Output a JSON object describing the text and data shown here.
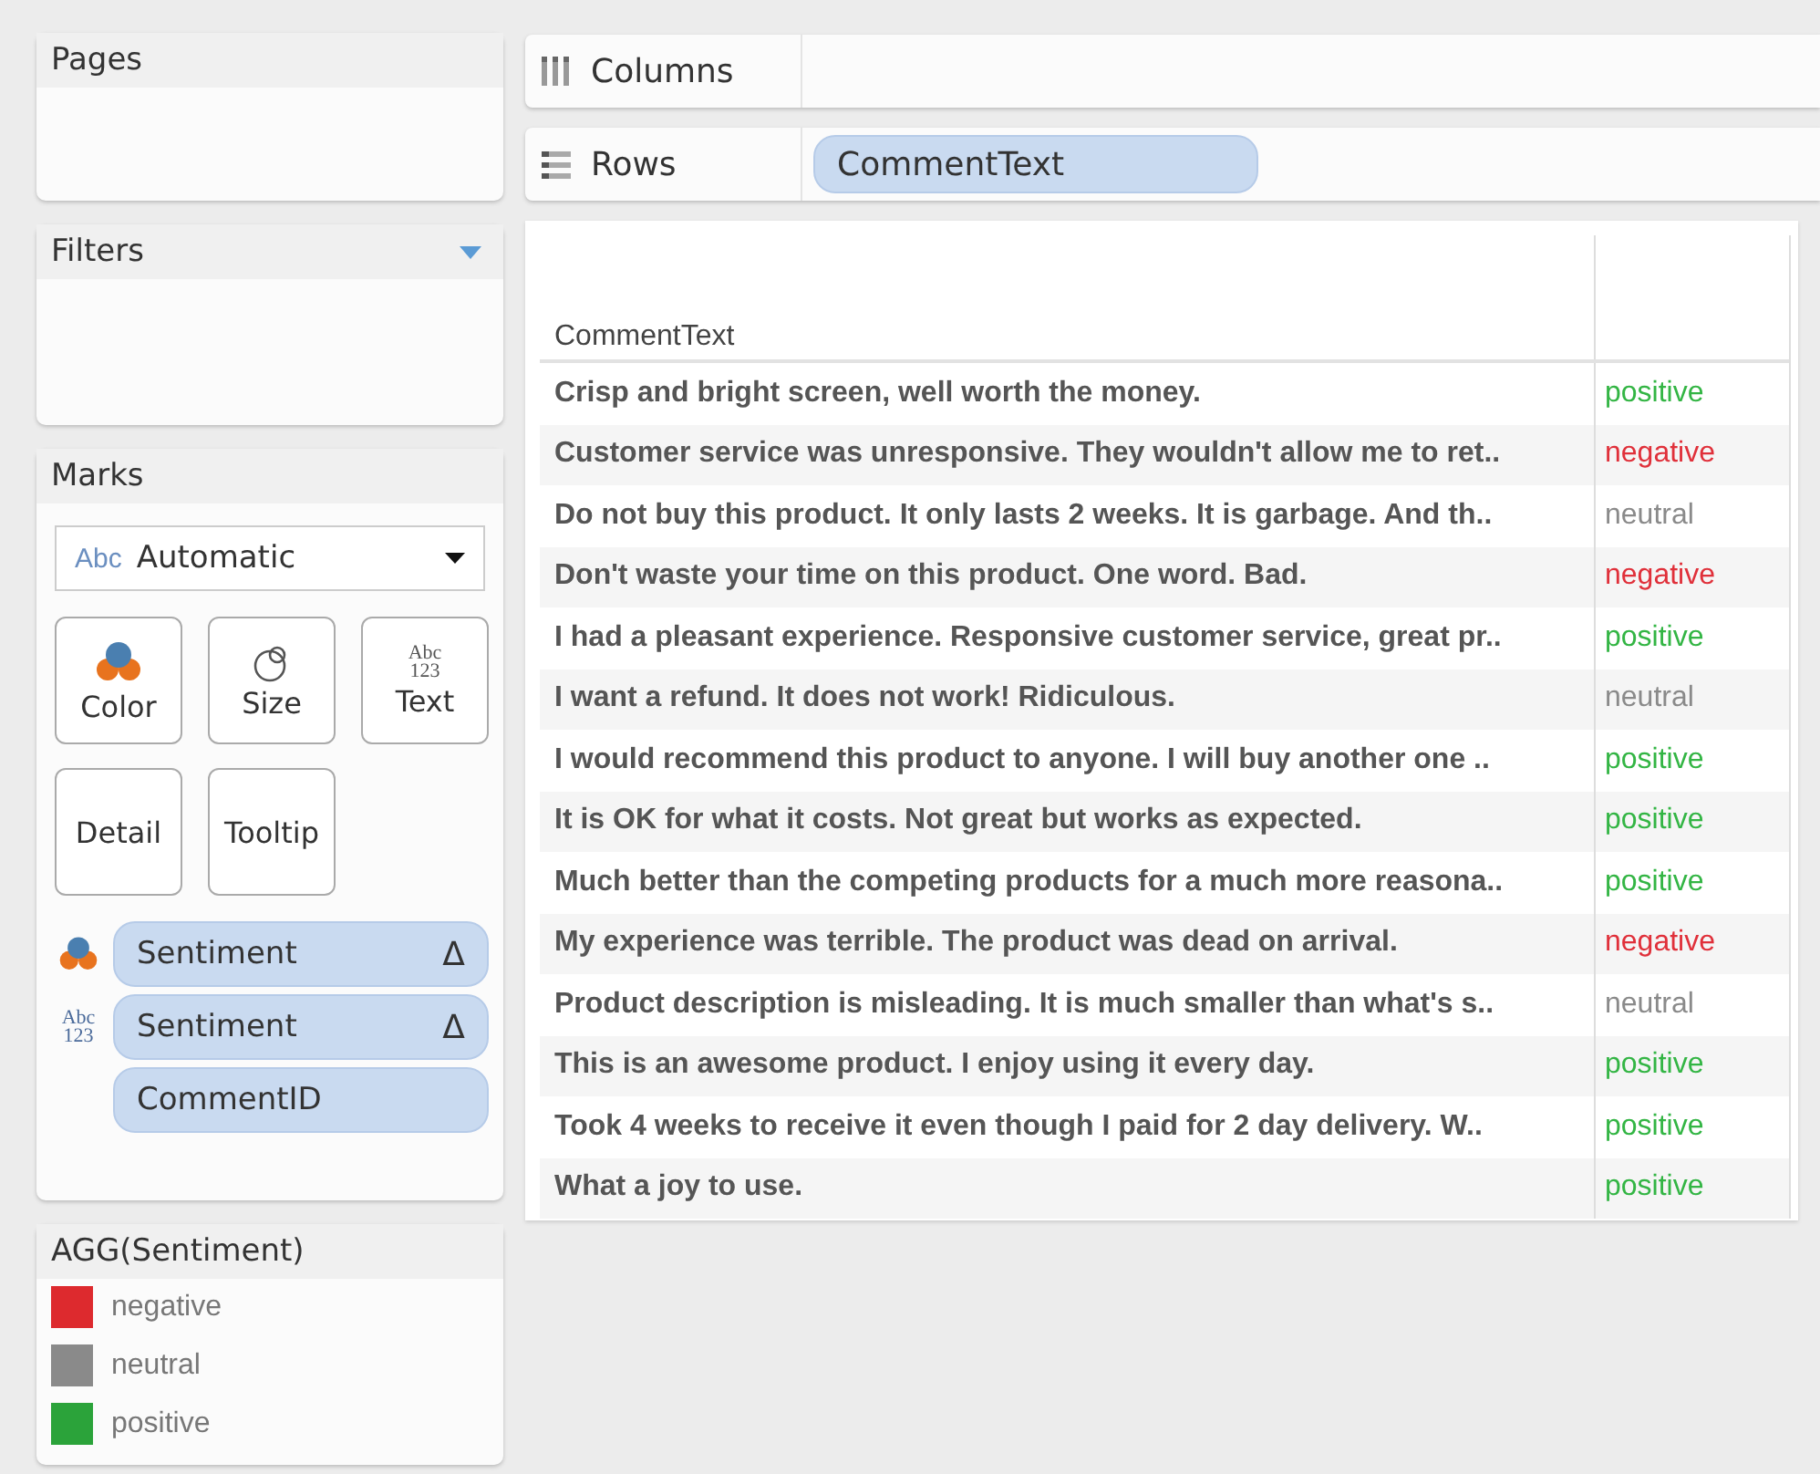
{
  "pages": {
    "title": "Pages"
  },
  "filters": {
    "title": "Filters"
  },
  "marks": {
    "title": "Marks",
    "mark_type": {
      "icon_text": "Abc",
      "value": "Automatic"
    },
    "cards": [
      {
        "kind": "color",
        "label": "Color"
      },
      {
        "kind": "size",
        "label": "Size"
      },
      {
        "kind": "text",
        "label": "Text",
        "icon_text": [
          "Abc",
          "123"
        ]
      },
      {
        "kind": "detail",
        "label": "Detail"
      },
      {
        "kind": "tooltip",
        "label": "Tooltip"
      }
    ],
    "pills": [
      {
        "kind": "color",
        "label": "Sentiment",
        "delta": "Δ"
      },
      {
        "kind": "text",
        "label": "Sentiment",
        "delta": "Δ",
        "icon_text": [
          "Abc",
          "123"
        ]
      },
      {
        "kind": "detail",
        "label": "CommentID"
      }
    ]
  },
  "legend": {
    "title": "AGG(Sentiment)",
    "items": [
      {
        "label": "negative",
        "color": "#dd2a2e"
      },
      {
        "label": "neutral",
        "color": "#8a8a8a"
      },
      {
        "label": "positive",
        "color": "#2ba33a"
      }
    ]
  },
  "columns_shelf": {
    "label": "Columns"
  },
  "rows_shelf": {
    "label": "Rows",
    "pills": [
      "CommentText"
    ]
  },
  "table": {
    "column_header": "CommentText",
    "rows": [
      {
        "comment": "Crisp and bright screen, well worth the money.",
        "sentiment": "positive",
        "color": "#33b544"
      },
      {
        "comment": "Customer service was unresponsive. They wouldn't allow me to ret..",
        "sentiment": "negative",
        "color": "#e0303a"
      },
      {
        "comment": "Do not buy this product. It only lasts 2 weeks. It is garbage. And th..",
        "sentiment": "neutral",
        "color": "#8a8a8a"
      },
      {
        "comment": "Don't waste your time on this product. One word. Bad.",
        "sentiment": "negative",
        "color": "#e0303a"
      },
      {
        "comment": "I had a pleasant experience. Responsive customer service, great pr..",
        "sentiment": "positive",
        "color": "#33b544"
      },
      {
        "comment": "I want a refund. It does not work! Ridiculous.",
        "sentiment": "neutral",
        "color": "#8a8a8a"
      },
      {
        "comment": "I would recommend this product to anyone. I will buy another one ..",
        "sentiment": "positive",
        "color": "#33b544"
      },
      {
        "comment": "It is OK for what it costs. Not great but works as expected.",
        "sentiment": "positive",
        "color": "#33b544"
      },
      {
        "comment": "Much better than the competing products for a much more reasona..",
        "sentiment": "positive",
        "color": "#33b544"
      },
      {
        "comment": "My experience was terrible. The product was dead on arrival.",
        "sentiment": "negative",
        "color": "#e0303a"
      },
      {
        "comment": "Product description is misleading. It is much smaller than what's s..",
        "sentiment": "neutral",
        "color": "#8a8a8a"
      },
      {
        "comment": "This is an awesome product. I enjoy using it every day.",
        "sentiment": "positive",
        "color": "#33b544"
      },
      {
        "comment": "Took 4 weeks to receive it even though I paid for 2 day delivery. W..",
        "sentiment": "positive",
        "color": "#33b544"
      },
      {
        "comment": "What a joy to use.",
        "sentiment": "positive",
        "color": "#33b544"
      }
    ]
  }
}
